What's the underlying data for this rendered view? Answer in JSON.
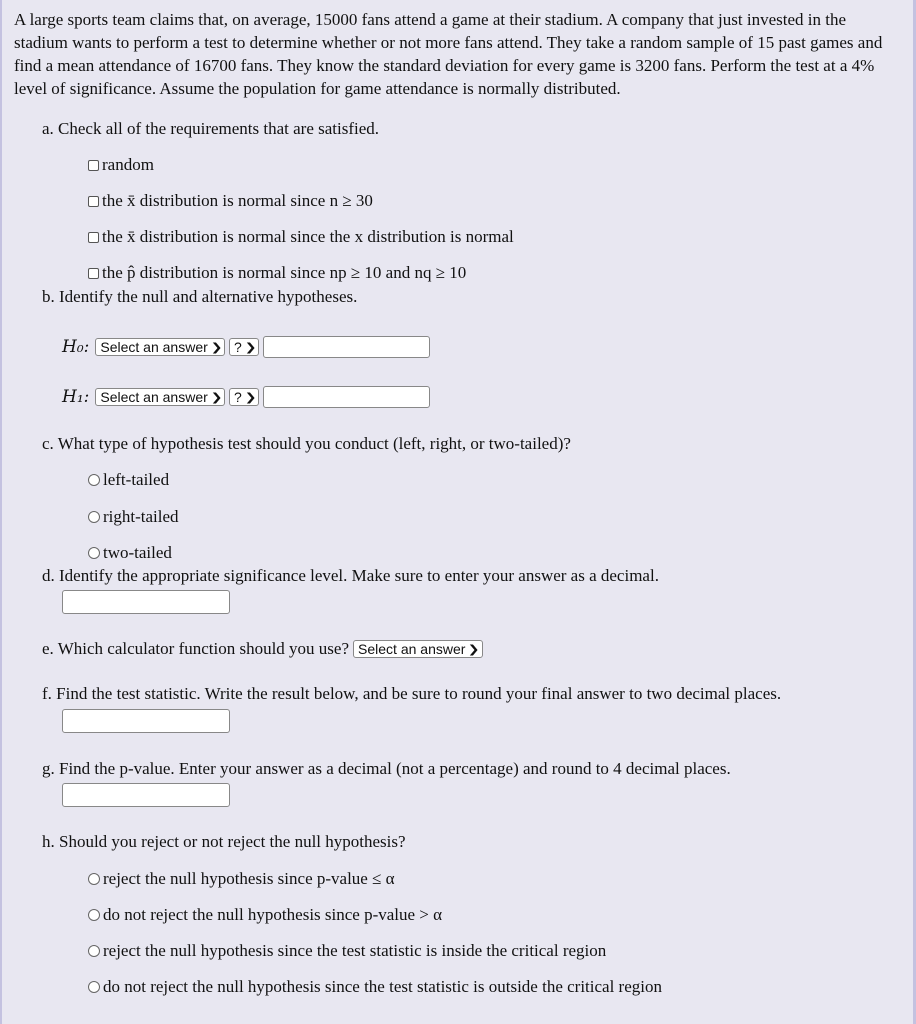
{
  "problem_text": "A large sports team claims that, on average, 15000 fans attend a game at their stadium. A company that just invested in the stadium wants to perform a test to determine whether or not more fans attend. They take a random sample of 15 past games and find a mean attendance of 16700 fans. They know the standard deviation for every game is 3200 fans. Perform the test at a 4% level of significance. Assume the population for game attendance is normally distributed.",
  "part_a": {
    "question": "a. Check all of the requirements that are satisfied.",
    "options": [
      {
        "label": "random",
        "checked": false
      },
      {
        "label": "the x̄ distribution is normal since n ≥ 30",
        "checked": false
      },
      {
        "label": "the x̄ distribution is normal since the x distribution is normal",
        "checked": false
      },
      {
        "label": "the p̂ distribution is normal since np ≥ 10 and nq ≥ 10",
        "checked": false
      }
    ]
  },
  "part_b": {
    "question": "b. Identify the null and alternative hypotheses.",
    "h0": {
      "label": "H₀:",
      "param_select": "Select an answer",
      "op_select": "?",
      "value": ""
    },
    "h1": {
      "label": "H₁:",
      "param_select": "Select an answer",
      "op_select": "?",
      "value": ""
    }
  },
  "part_c": {
    "question": "c. What type of hypothesis test should you conduct (left, right, or two-tailed)?",
    "options": [
      "left-tailed",
      "right-tailed",
      "two-tailed"
    ]
  },
  "part_d": {
    "question": "d. Identify the appropriate significance level. Make sure to enter your answer as a decimal.",
    "value": ""
  },
  "part_e": {
    "question": "e. Which calculator function should you use?",
    "select": "Select an answer"
  },
  "part_f": {
    "question": "f. Find the test statistic. Write the result below, and be sure to round your final answer to two decimal places.",
    "value": ""
  },
  "part_g": {
    "question": "g. Find the p-value. Enter your answer as a decimal (not a percentage) and round to 4 decimal places.",
    "value": ""
  },
  "part_h": {
    "question": "h. Should you reject or not reject the null hypothesis?",
    "options": [
      "reject the null hypothesis since p-value ≤ α",
      "do not reject the null hypothesis since p-value > α",
      "reject the null hypothesis since the test statistic is inside the critical region",
      "do not reject the null hypothesis since the test statistic is outside the critical region"
    ]
  },
  "icons": {
    "chevron": "chevron-down-icon"
  }
}
